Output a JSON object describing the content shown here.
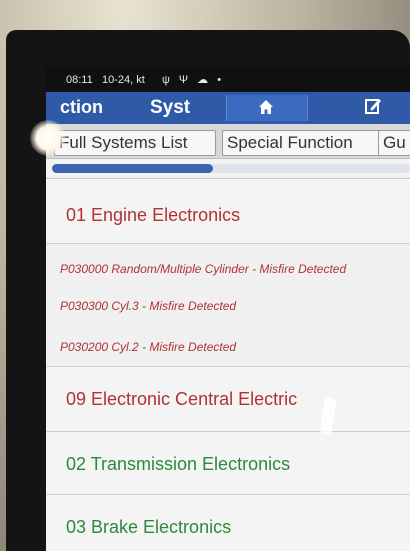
{
  "status": {
    "time": "08:11",
    "date": "10-24, kt",
    "icons": [
      "usb-icon",
      "usb-debug-icon",
      "cloud-icon",
      "dot-icon"
    ]
  },
  "titlebar": {
    "left_fragment": "ction",
    "middle_fragment": "Syst",
    "home_icon": "home-icon",
    "edit_icon": "edit-icon"
  },
  "tabs": [
    {
      "label": "Full Systems List"
    },
    {
      "label": "Special Function"
    },
    {
      "label": "Gu"
    }
  ],
  "progress": {
    "fill_fraction": 0.45
  },
  "systems": [
    {
      "label": "01 Engine Electronics",
      "status_color": "#b03232"
    },
    {
      "label": "09 Electronic Central Electric",
      "status_color": "#b03232"
    },
    {
      "label": "02 Transmission Electronics",
      "status_color": "#2c8a3a"
    },
    {
      "label": "03 Brake Electronics",
      "status_color": "#2c8a3a"
    }
  ],
  "dtcs": [
    "P030000 Random/Multiple Cylinder - Misfire Detected",
    "P030300 Cyl.3 - Misfire Detected",
    "P030200 Cyl.2 - Misfire Detected"
  ]
}
